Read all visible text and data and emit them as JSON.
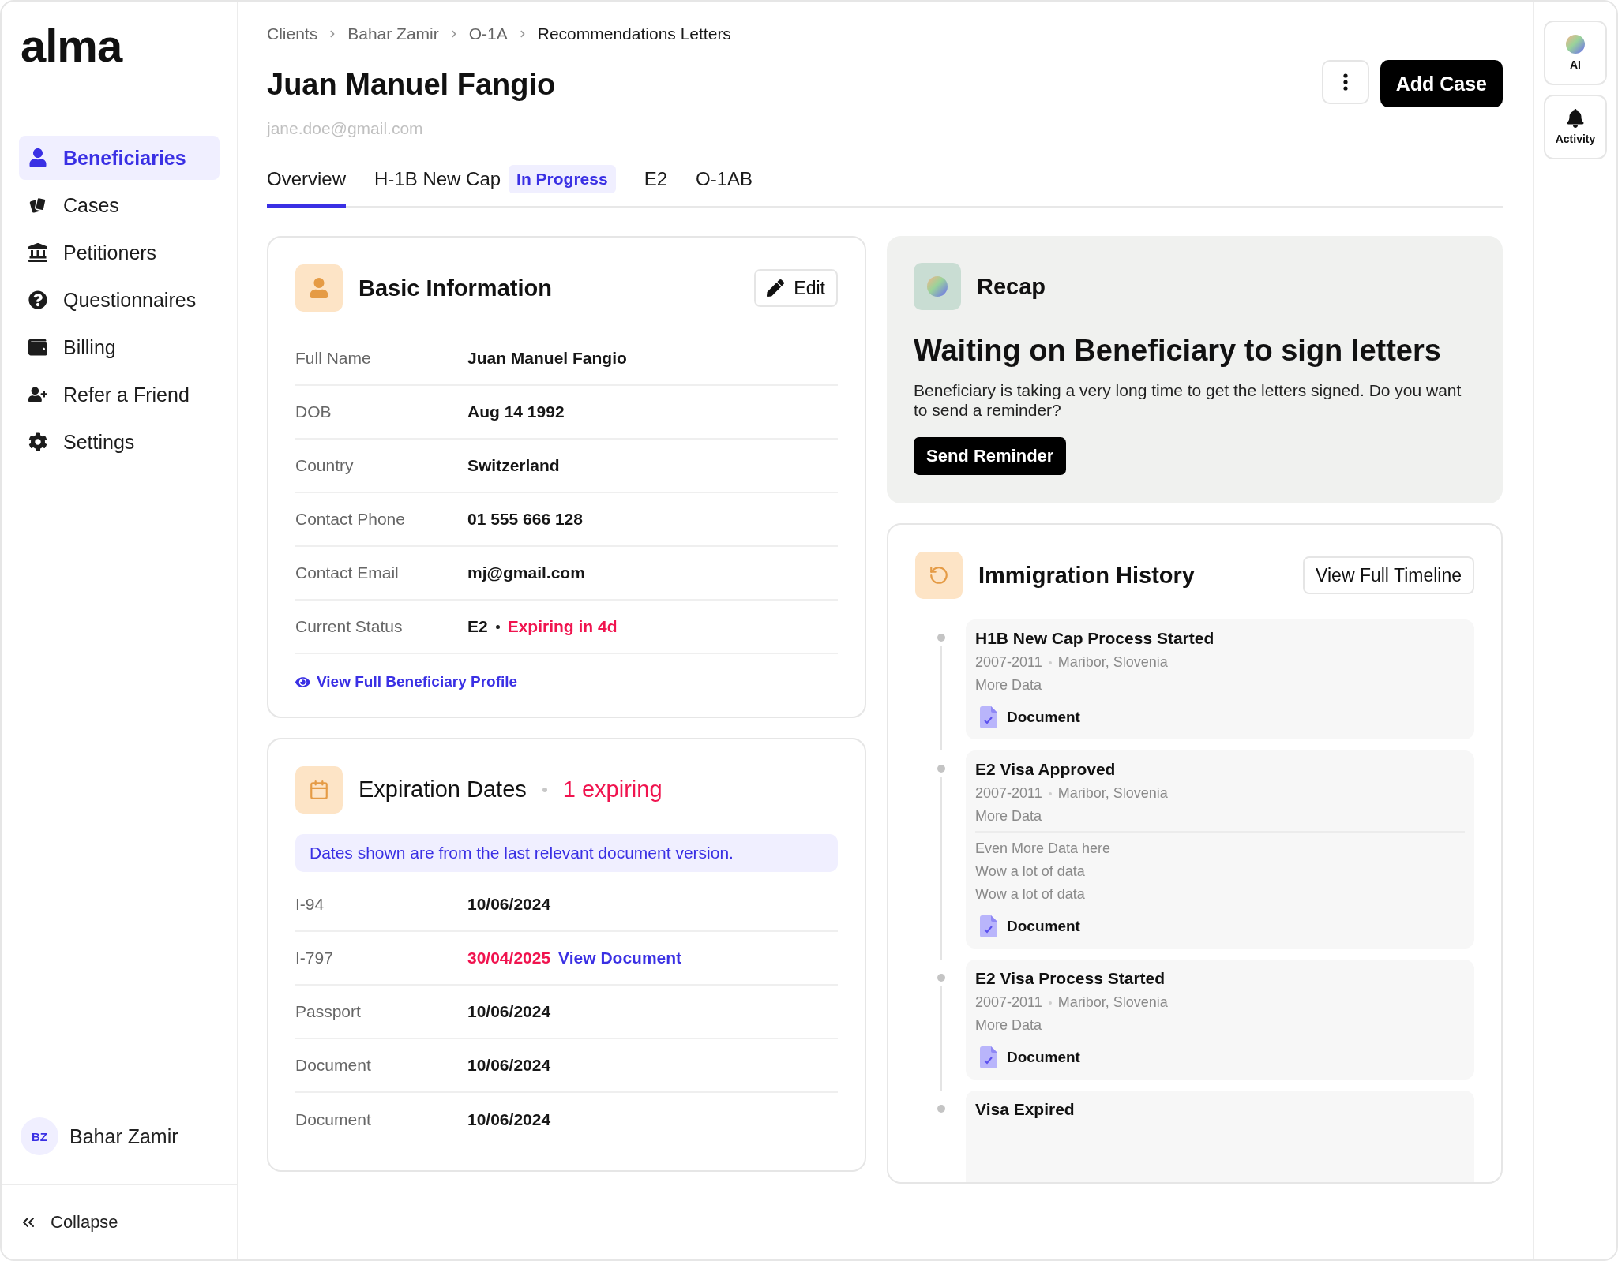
{
  "logo": "alma",
  "sidebar": {
    "items": [
      {
        "label": "Beneficiaries",
        "kind": "beneficiaries",
        "selected": true
      },
      {
        "label": "Cases",
        "kind": "cases",
        "selected": false
      },
      {
        "label": "Petitioners",
        "kind": "petitioners",
        "selected": false
      },
      {
        "label": "Questionnaires",
        "kind": "questionnaires",
        "selected": false
      },
      {
        "label": "Billing",
        "kind": "billing",
        "selected": false
      },
      {
        "label": "Refer a Friend",
        "kind": "referral",
        "selected": false
      },
      {
        "label": "Settings",
        "kind": "settings",
        "selected": false
      }
    ],
    "user": {
      "initials": "BZ",
      "name": "Bahar Zamir"
    },
    "collapse": "Collapse"
  },
  "breadcrumb": [
    "Clients",
    "Bahar Zamir",
    "O-1A",
    "Recommendations Letters"
  ],
  "title": "Juan Manuel Fangio",
  "email": "jane.doe@gmail.com",
  "add_case": "Add Case",
  "tabs": [
    {
      "label": "Overview",
      "selected": true
    },
    {
      "label": "H-1B New Cap",
      "badge": "In Progress",
      "selected": false
    },
    {
      "label": "E2",
      "selected": false
    },
    {
      "label": "O-1AB",
      "selected": false
    }
  ],
  "basic_information": {
    "title": "Basic Information",
    "edit": "Edit",
    "rows": [
      {
        "label": "Full Name",
        "value": "Juan Manuel Fangio"
      },
      {
        "label": "DOB",
        "value": "Aug 14 1992"
      },
      {
        "label": "Country",
        "value": "Switzerland"
      },
      {
        "label": "Contact Phone",
        "value": "01 555 666 128"
      },
      {
        "label": "Contact Email",
        "value": "mj@gmail.com"
      },
      {
        "label": "Current Status",
        "value": "E2",
        "alert": "Expiring in 4d"
      }
    ],
    "link": "View Full Beneficiary Profile"
  },
  "expiration_dates": {
    "title": "Expiration Dates",
    "expiring": "1 expiring",
    "notice": "Dates shown are from the last relevant document version.",
    "rows": [
      {
        "label": "I-94",
        "value": "10/06/2024",
        "expiring": false
      },
      {
        "label": "I-797",
        "value": "30/04/2025",
        "expiring": true,
        "link": "View Document"
      },
      {
        "label": "Passport",
        "value": "10/06/2024",
        "expiring": false
      },
      {
        "label": "Document",
        "value": "10/06/2024",
        "expiring": false
      },
      {
        "label": "Document",
        "value": "10/06/2024",
        "expiring": false
      }
    ]
  },
  "recap": {
    "title": "Recap",
    "heading": "Waiting on Beneficiary to sign letters",
    "body": "Beneficiary is taking a very long time to get the letters signed. Do you want to send a reminder?",
    "button": "Send Reminder"
  },
  "immigration_history": {
    "title": "Immigration History",
    "button": "View Full Timeline",
    "events": [
      {
        "title": "H1B New Cap Process Started",
        "years": "2007-2011",
        "place": "Maribor, Slovenia",
        "lines": [
          "More Data"
        ],
        "document": "Document"
      },
      {
        "title": "E2 Visa Approved",
        "years": "2007-2011",
        "place": "Maribor, Slovenia",
        "lines": [
          "More Data"
        ],
        "extra": [
          "Even More Data here",
          "Wow a lot of data",
          "Wow a lot of data"
        ],
        "document": "Document"
      },
      {
        "title": "E2 Visa Process Started",
        "years": "2007-2011",
        "place": "Maribor, Slovenia",
        "lines": [
          "More Data"
        ],
        "document": "Document"
      },
      {
        "title": "Visa Expired"
      }
    ]
  },
  "rail": [
    {
      "label": "AI",
      "kind": "ai"
    },
    {
      "label": "Activity",
      "kind": "activity"
    }
  ]
}
